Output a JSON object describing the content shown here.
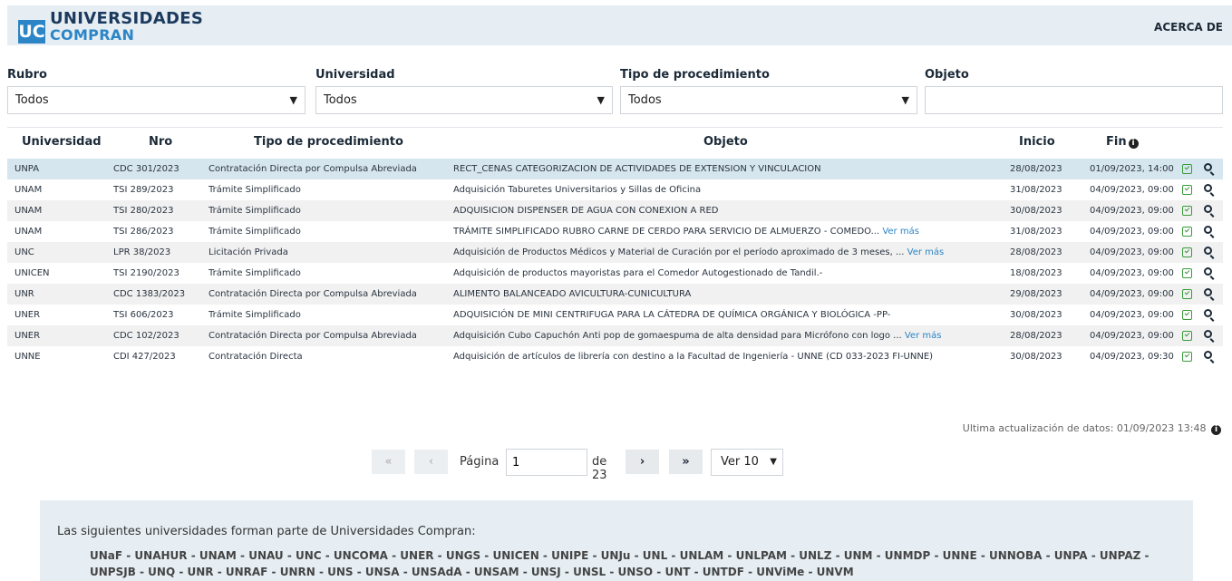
{
  "header": {
    "logo_mark": "UC",
    "logo_line1": "UNIVERSIDADES",
    "logo_line2": "COMPRAN",
    "nav_about": "ACERCA DE"
  },
  "filters": {
    "rubro_label": "Rubro",
    "rubro_value": "Todos",
    "universidad_label": "Universidad",
    "universidad_value": "Todos",
    "tipo_label": "Tipo de procedimiento",
    "tipo_value": "Todos",
    "objeto_label": "Objeto",
    "objeto_value": ""
  },
  "table": {
    "headers": {
      "universidad": "Universidad",
      "nro": "Nro",
      "tipo": "Tipo de procedimiento",
      "objeto": "Objeto",
      "inicio": "Inicio",
      "fin": "Fin"
    },
    "ver_mas": "Ver más",
    "rows": [
      {
        "univ": "UNPA",
        "nro": "CDC 301/2023",
        "tipo": "Contratación Directa por Compulsa Abreviada",
        "objeto": "RECT_CENAS CATEGORIZACION DE ACTIVIDADES DE EXTENSION Y VINCULACION",
        "mas": "",
        "inicio": "28/08/2023",
        "fin": "01/09/2023, 14:00"
      },
      {
        "univ": "UNAM",
        "nro": "TSI 289/2023",
        "tipo": "Trámite Simplificado",
        "objeto": "Adquisición Taburetes Universitarios y Sillas de Oficina",
        "mas": "",
        "inicio": "31/08/2023",
        "fin": "04/09/2023, 09:00"
      },
      {
        "univ": "UNAM",
        "nro": "TSI 280/2023",
        "tipo": "Trámite Simplificado",
        "objeto": "ADQUISICION DISPENSER DE AGUA CON CONEXION A RED",
        "mas": "",
        "inicio": "30/08/2023",
        "fin": "04/09/2023, 09:00"
      },
      {
        "univ": "UNAM",
        "nro": "TSI 286/2023",
        "tipo": "Trámite Simplificado",
        "objeto": "TRÁMITE SIMPLIFICADO RUBRO CARNE DE CERDO PARA SERVICIO DE ALMUERZO - COMEDO... ",
        "mas": "Ver más",
        "inicio": "31/08/2023",
        "fin": "04/09/2023, 09:00"
      },
      {
        "univ": "UNC",
        "nro": "LPR 38/2023",
        "tipo": "Licitación Privada",
        "objeto": "Adquisición de Productos Médicos y Material de Curación por el período aproximado de 3 meses, ... ",
        "mas": "Ver más",
        "inicio": "28/08/2023",
        "fin": "04/09/2023, 09:00"
      },
      {
        "univ": "UNICEN",
        "nro": "TSI 2190/2023",
        "tipo": "Trámite Simplificado",
        "objeto": "Adquisición de productos mayoristas para el Comedor Autogestionado de Tandil.-",
        "mas": "",
        "inicio": "18/08/2023",
        "fin": "04/09/2023, 09:00"
      },
      {
        "univ": "UNR",
        "nro": "CDC 1383/2023",
        "tipo": "Contratación Directa por Compulsa Abreviada",
        "objeto": "ALIMENTO BALANCEADO AVICULTURA-CUNICULTURA",
        "mas": "",
        "inicio": "29/08/2023",
        "fin": "04/09/2023, 09:00"
      },
      {
        "univ": "UNER",
        "nro": "TSI 606/2023",
        "tipo": "Trámite Simplificado",
        "objeto": "ADQUISICIÓN DE MINI CENTRIFUGA PARA LA CÁTEDRA DE QUÍMICA ORGÁNICA Y BIOLÓGICA -PP-",
        "mas": "",
        "inicio": "30/08/2023",
        "fin": "04/09/2023, 09:00"
      },
      {
        "univ": "UNER",
        "nro": "CDC 102/2023",
        "tipo": "Contratación Directa por Compulsa Abreviada",
        "objeto": "Adquisición Cubo Capuchón Anti pop de gomaespuma de alta densidad para Micrófono con logo ... ",
        "mas": "Ver más",
        "inicio": "28/08/2023",
        "fin": "04/09/2023, 09:00"
      },
      {
        "univ": "UNNE",
        "nro": "CDI 427/2023",
        "tipo": "Contratación Directa",
        "objeto": "Adquisición de artículos de librería con destino a la Facultad de Ingeniería - UNNE (CD 033-2023 FI-UNNE)",
        "mas": "",
        "inicio": "30/08/2023",
        "fin": "04/09/2023, 09:30"
      }
    ]
  },
  "updated_text": "Ultima actualización de datos: 01/09/2023 13:48",
  "pager": {
    "first": "«",
    "prev": "‹",
    "page_label": "Página",
    "page_value": "1",
    "of_label": "de 23",
    "next": "›",
    "last": "»",
    "per_page": "Ver 10"
  },
  "footer": {
    "title": "Las siguientes universidades forman parte de Universidades Compran:",
    "list": "UNaF - UNAHUR - UNAM - UNAU - UNC - UNCOMA - UNER - UNGS - UNICEN - UNIPE - UNJu - UNL - UNLAM - UNLPAM - UNLZ - UNM - UNMDP - UNNE - UNNOBA - UNPA - UNPAZ - UNPSJB - UNQ - UNR - UNRAF - UNRN - UNS - UNSA - UNSAdA - UNSAM - UNSJ - UNSL - UNSO - UNT - UNTDF - UNViMe - UNVM"
  },
  "colors": {
    "header_bg": "#e6eef3",
    "brand_blue": "#2c85c6",
    "brand_dark": "#1c3a5e",
    "selected_row": "#d6e6ee",
    "check_green": "#3a9a3a"
  }
}
